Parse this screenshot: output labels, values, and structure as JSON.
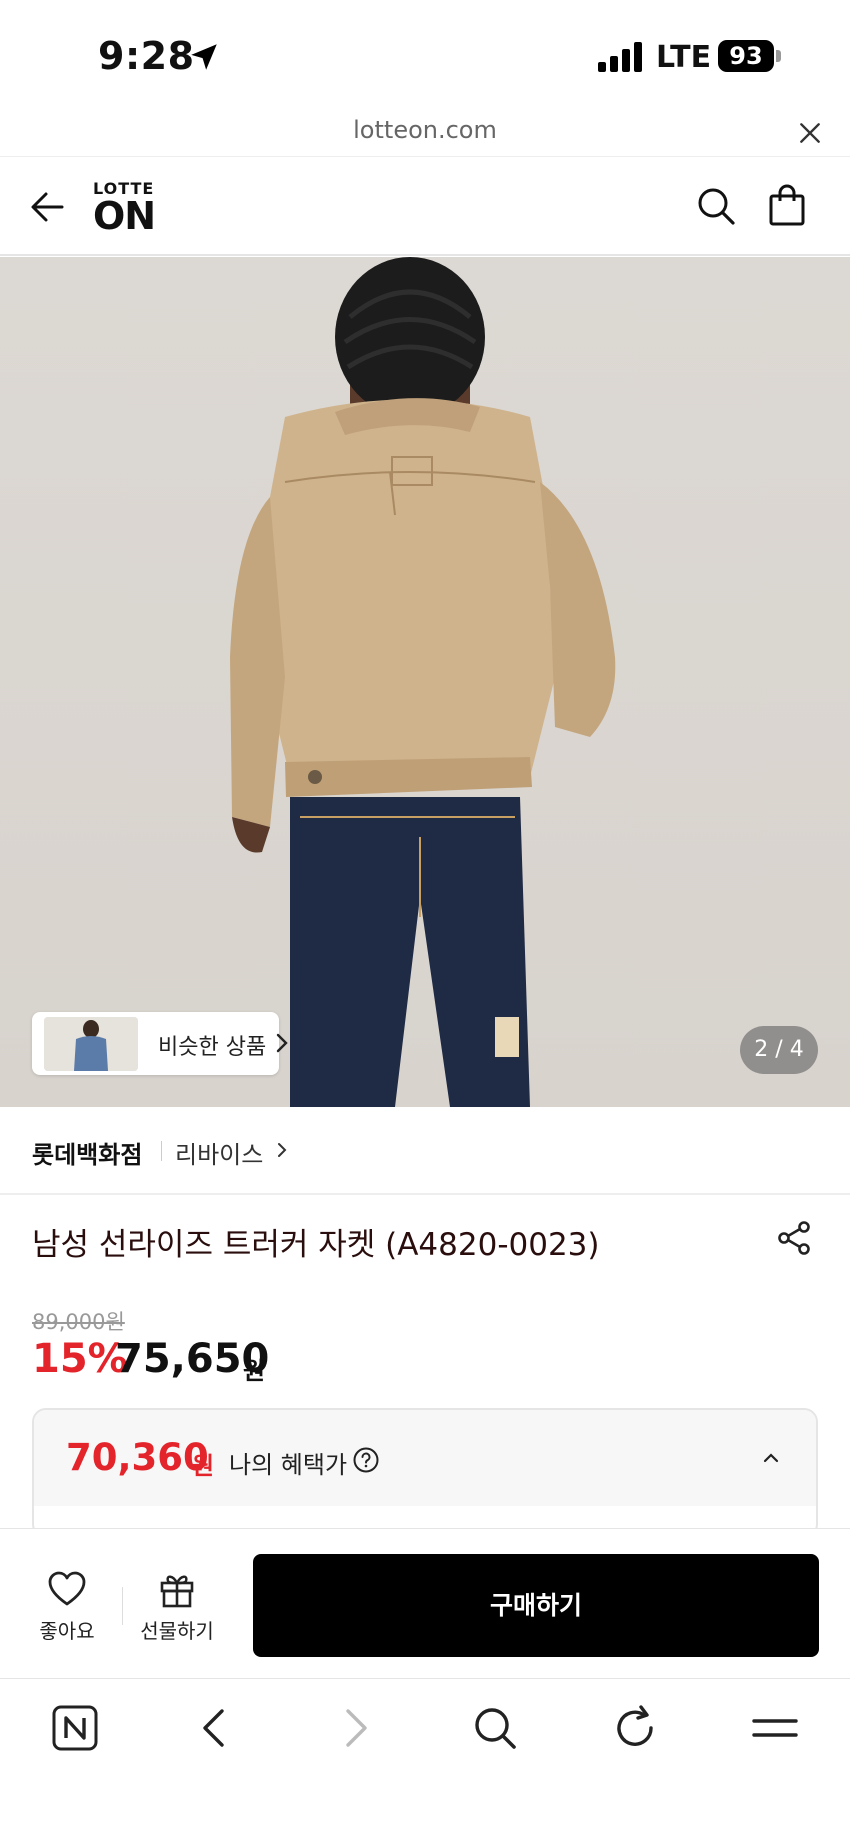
{
  "status_bar": {
    "time": "9:28",
    "network": "LTE",
    "battery": "93",
    "icons": [
      "location-arrow-icon",
      "signal-icon",
      "battery-icon"
    ]
  },
  "browser": {
    "url": "lotteon.com",
    "close_icon": "close-icon"
  },
  "header": {
    "logo_top": "LOTTE",
    "logo_main": "ON",
    "icons": [
      "back-arrow-icon",
      "search-icon",
      "shopping-bag-icon"
    ]
  },
  "gallery": {
    "similar_label": "비슷한 상품",
    "page_indicator": "2 / 4",
    "current_page": 2,
    "total_pages": 4
  },
  "brand": {
    "store": "롯데백화점",
    "name": "리바이스"
  },
  "product": {
    "title": "남성 선라이즈 트러커 자켓 (A4820-0023)",
    "original_price": "89,000원",
    "discount": "15%",
    "sale_price": "75,650",
    "sale_unit": "원"
  },
  "benefit": {
    "price": "70,360",
    "unit": "원",
    "label": "나의 혜택가"
  },
  "actions": {
    "like_label": "좋아요",
    "gift_label": "선물하기",
    "buy_label": "구매하기"
  },
  "browser_nav": {
    "icons": [
      "naver-n-icon",
      "back-icon",
      "forward-icon",
      "search-icon",
      "refresh-icon",
      "menu-icon"
    ]
  },
  "colors": {
    "accent_red": "#e3242b",
    "buy_button": "#000000",
    "jacket": "#cfb38c",
    "jeans": "#1f2a44"
  }
}
